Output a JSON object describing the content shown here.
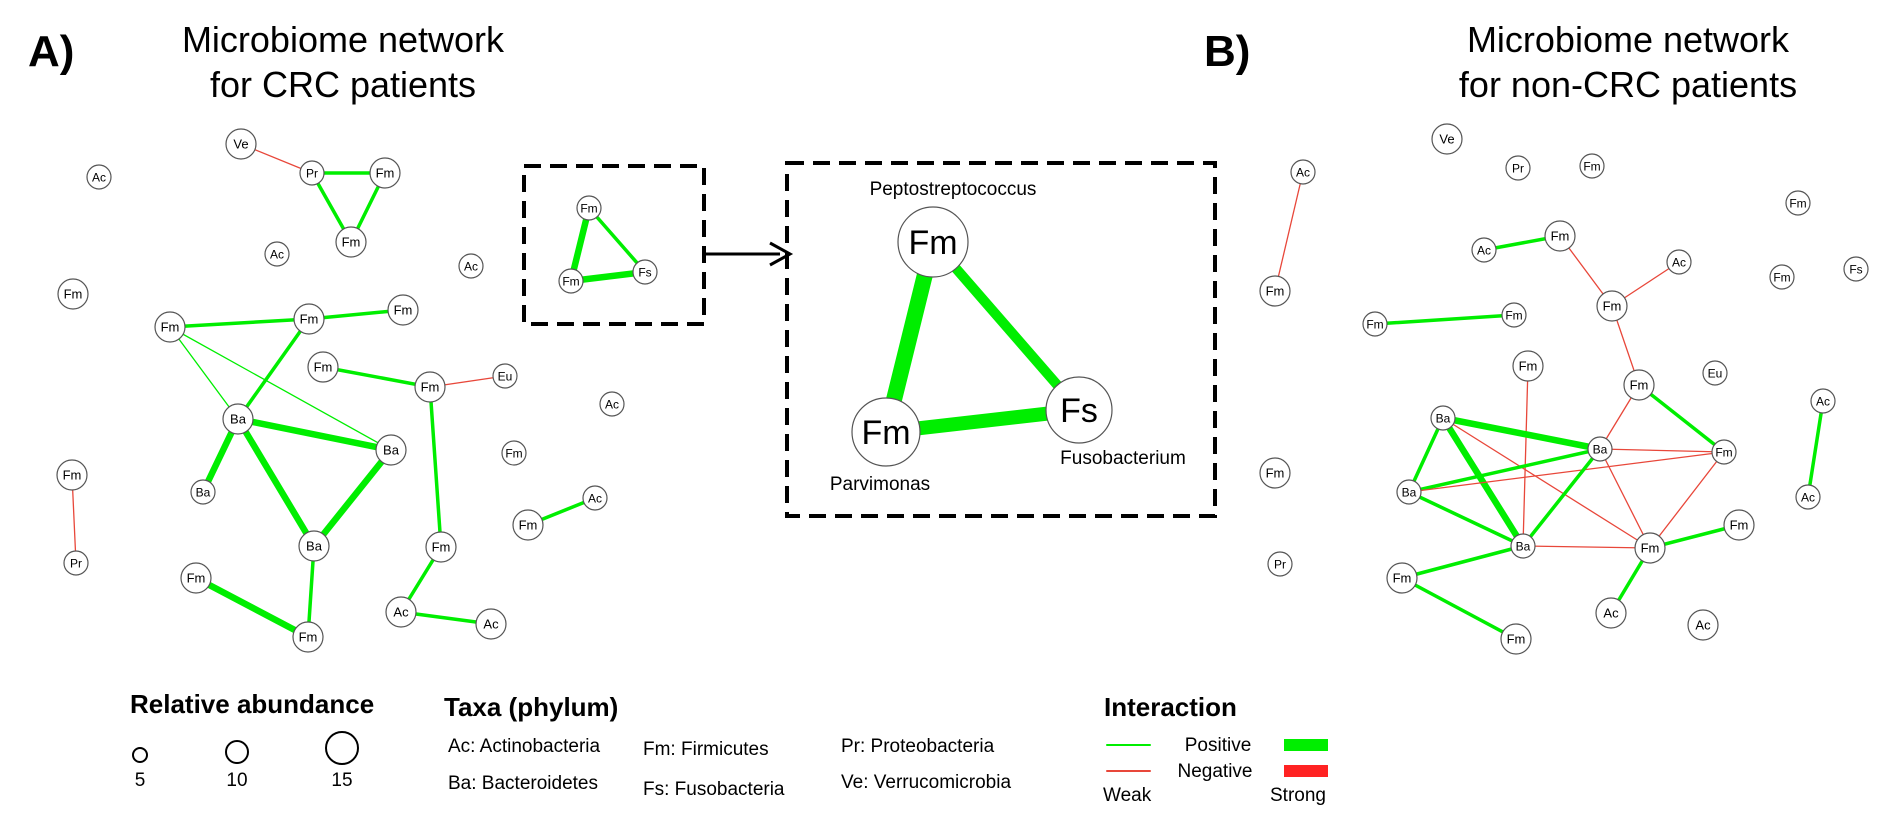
{
  "panel_a": {
    "letter": "A)",
    "title_line1": "Microbiome network",
    "title_line2": "for CRC patients"
  },
  "panel_b": {
    "letter": "B)",
    "title_line1": "Microbiome network",
    "title_line2": "for non-CRC patients"
  },
  "zoom": {
    "top_label": "Peptostreptococcus",
    "left_label": "Parvimonas",
    "right_label": "Fusobacterium",
    "nodes": [
      "Fm",
      "Fm",
      "Fs"
    ]
  },
  "legend": {
    "abundance": {
      "title": "Relative abundance",
      "sizes": [
        "5",
        "10",
        "15"
      ]
    },
    "taxa": {
      "title": "Taxa (phylum)",
      "entries": [
        "Ac: Actinobacteria",
        "Ba: Bacteroidetes",
        "Fm: Firmicutes",
        "Fs: Fusobacteria",
        "Pr: Proteobacteria",
        "Ve: Verrucomicrobia"
      ]
    },
    "interaction": {
      "title": "Interaction",
      "positive": "Positive",
      "negative": "Negative",
      "weak": "Weak",
      "strong": "Strong",
      "colors": {
        "positive": "#00ee00",
        "negative": "#e8473a"
      }
    }
  },
  "network_a": {
    "nodes": [
      {
        "id": "a1",
        "label": "Ve",
        "size": "m"
      },
      {
        "id": "a2",
        "label": "Pr",
        "size": "s"
      },
      {
        "id": "a3",
        "label": "Fm",
        "size": "m"
      },
      {
        "id": "a4",
        "label": "Fm",
        "size": "m"
      },
      {
        "id": "a5",
        "label": "Ac",
        "size": "s"
      },
      {
        "id": "a6",
        "label": "Ac",
        "size": "s"
      },
      {
        "id": "a7",
        "label": "Ac",
        "size": "s"
      },
      {
        "id": "a8",
        "label": "Fm",
        "size": "m"
      },
      {
        "id": "a9",
        "label": "Fm",
        "size": "m"
      },
      {
        "id": "a10",
        "label": "Fm",
        "size": "m"
      },
      {
        "id": "a11",
        "label": "Fm",
        "size": "m"
      },
      {
        "id": "a12",
        "label": "Fm",
        "size": "m"
      },
      {
        "id": "a13",
        "label": "Fm",
        "size": "m"
      },
      {
        "id": "a14",
        "label": "Eu",
        "size": "s"
      },
      {
        "id": "a15",
        "label": "Ac",
        "size": "s"
      },
      {
        "id": "a16",
        "label": "Ba",
        "size": "m"
      },
      {
        "id": "a17",
        "label": "Ba",
        "size": "m"
      },
      {
        "id": "a18",
        "label": "Ba",
        "size": "s"
      },
      {
        "id": "a19",
        "label": "Fm",
        "size": "s"
      },
      {
        "id": "a20",
        "label": "Fm",
        "size": "m"
      },
      {
        "id": "a21",
        "label": "Pr",
        "size": "s"
      },
      {
        "id": "a22",
        "label": "Ac",
        "size": "s"
      },
      {
        "id": "a23",
        "label": "Fm",
        "size": "m"
      },
      {
        "id": "a24",
        "label": "Ba",
        "size": "m"
      },
      {
        "id": "a25",
        "label": "Fm",
        "size": "m"
      },
      {
        "id": "a26",
        "label": "Fm",
        "size": "m"
      },
      {
        "id": "a27",
        "label": "Fm",
        "size": "m"
      },
      {
        "id": "a28",
        "label": "Ac",
        "size": "m"
      },
      {
        "id": "a29",
        "label": "Ac",
        "size": "m"
      },
      {
        "id": "a30",
        "label": "Fm",
        "size": "s"
      },
      {
        "id": "a31",
        "label": "Fm",
        "size": "s"
      },
      {
        "id": "a32",
        "label": "Fs",
        "size": "s"
      }
    ],
    "edges": [
      {
        "from": "a1",
        "to": "a2",
        "sign": "negative",
        "strength": "weak"
      },
      {
        "from": "a2",
        "to": "a3",
        "sign": "positive",
        "strength": "medium"
      },
      {
        "from": "a2",
        "to": "a4",
        "sign": "positive",
        "strength": "medium"
      },
      {
        "from": "a3",
        "to": "a4",
        "sign": "positive",
        "strength": "medium"
      },
      {
        "from": "a9",
        "to": "a10",
        "sign": "positive",
        "strength": "medium"
      },
      {
        "from": "a10",
        "to": "a11",
        "sign": "positive",
        "strength": "medium"
      },
      {
        "from": "a9",
        "to": "a16",
        "sign": "positive",
        "strength": "weak"
      },
      {
        "from": "a9",
        "to": "a17",
        "sign": "positive",
        "strength": "weak"
      },
      {
        "from": "a10",
        "to": "a16",
        "sign": "positive",
        "strength": "medium"
      },
      {
        "from": "a16",
        "to": "a17",
        "sign": "positive",
        "strength": "strong"
      },
      {
        "from": "a16",
        "to": "a18",
        "sign": "positive",
        "strength": "strong"
      },
      {
        "from": "a16",
        "to": "a24",
        "sign": "positive",
        "strength": "strong"
      },
      {
        "from": "a17",
        "to": "a24",
        "sign": "positive",
        "strength": "strong"
      },
      {
        "from": "a24",
        "to": "a26",
        "sign": "positive",
        "strength": "medium"
      },
      {
        "from": "a25",
        "to": "a26",
        "sign": "positive",
        "strength": "strong"
      },
      {
        "from": "a12",
        "to": "a13",
        "sign": "positive",
        "strength": "medium"
      },
      {
        "from": "a13",
        "to": "a14",
        "sign": "negative",
        "strength": "weak"
      },
      {
        "from": "a13",
        "to": "a27",
        "sign": "positive",
        "strength": "medium"
      },
      {
        "from": "a27",
        "to": "a28",
        "sign": "positive",
        "strength": "medium"
      },
      {
        "from": "a28",
        "to": "a29",
        "sign": "positive",
        "strength": "medium"
      },
      {
        "from": "a20",
        "to": "a21",
        "sign": "negative",
        "strength": "weak"
      },
      {
        "from": "a22",
        "to": "a23",
        "sign": "positive",
        "strength": "medium"
      },
      {
        "from": "a30",
        "to": "a31",
        "sign": "positive",
        "strength": "strong"
      },
      {
        "from": "a30",
        "to": "a32",
        "sign": "positive",
        "strength": "medium"
      },
      {
        "from": "a31",
        "to": "a32",
        "sign": "positive",
        "strength": "strong"
      }
    ]
  },
  "network_b": {
    "nodes": [
      {
        "id": "b1",
        "label": "Ac",
        "size": "s"
      },
      {
        "id": "b2",
        "label": "Fm",
        "size": "m"
      },
      {
        "id": "b3",
        "label": "Fm",
        "size": "m"
      },
      {
        "id": "b4",
        "label": "Pr",
        "size": "s"
      },
      {
        "id": "b5",
        "label": "Ve",
        "size": "m"
      },
      {
        "id": "b6",
        "label": "Pr",
        "size": "s"
      },
      {
        "id": "b7",
        "label": "Fm",
        "size": "s"
      },
      {
        "id": "b8",
        "label": "Fm",
        "size": "s"
      },
      {
        "id": "b9",
        "label": "Fm",
        "size": "s"
      },
      {
        "id": "b10",
        "label": "Fs",
        "size": "s"
      },
      {
        "id": "b11",
        "label": "Ac",
        "size": "s"
      },
      {
        "id": "b12",
        "label": "Fm",
        "size": "m"
      },
      {
        "id": "b13",
        "label": "Ac",
        "size": "s"
      },
      {
        "id": "b14",
        "label": "Fm",
        "size": "s"
      },
      {
        "id": "b15",
        "label": "Fm",
        "size": "s"
      },
      {
        "id": "b16",
        "label": "Fm",
        "size": "m"
      },
      {
        "id": "b17",
        "label": "Fm",
        "size": "m"
      },
      {
        "id": "b18",
        "label": "Eu",
        "size": "s"
      },
      {
        "id": "b19",
        "label": "Fm",
        "size": "m"
      },
      {
        "id": "b20",
        "label": "Ac",
        "size": "s"
      },
      {
        "id": "b21",
        "label": "Ba",
        "size": "s"
      },
      {
        "id": "b22",
        "label": "Ba",
        "size": "s"
      },
      {
        "id": "b23",
        "label": "Fm",
        "size": "s"
      },
      {
        "id": "b24",
        "label": "Ba",
        "size": "s"
      },
      {
        "id": "b25",
        "label": "Ac",
        "size": "s"
      },
      {
        "id": "b26",
        "label": "Fm",
        "size": "m"
      },
      {
        "id": "b27",
        "label": "Ba",
        "size": "s"
      },
      {
        "id": "b28",
        "label": "Fm",
        "size": "m"
      },
      {
        "id": "b29",
        "label": "Fm",
        "size": "m"
      },
      {
        "id": "b30",
        "label": "Ac",
        "size": "m"
      },
      {
        "id": "b31",
        "label": "Ac",
        "size": "m"
      },
      {
        "id": "b32",
        "label": "Fm",
        "size": "m"
      }
    ],
    "edges": [
      {
        "from": "b1",
        "to": "b2",
        "sign": "negative",
        "strength": "weak"
      },
      {
        "from": "b11",
        "to": "b12",
        "sign": "positive",
        "strength": "medium"
      },
      {
        "from": "b12",
        "to": "b16",
        "sign": "negative",
        "strength": "weak"
      },
      {
        "from": "b13",
        "to": "b16",
        "sign": "negative",
        "strength": "weak"
      },
      {
        "from": "b16",
        "to": "b19",
        "sign": "negative",
        "strength": "weak"
      },
      {
        "from": "b14",
        "to": "b15",
        "sign": "positive",
        "strength": "medium"
      },
      {
        "from": "b19",
        "to": "b22",
        "sign": "negative",
        "strength": "weak"
      },
      {
        "from": "b19",
        "to": "b23",
        "sign": "positive",
        "strength": "medium"
      },
      {
        "from": "b17",
        "to": "b27",
        "sign": "negative",
        "strength": "weak"
      },
      {
        "from": "b21",
        "to": "b22",
        "sign": "positive",
        "strength": "strong"
      },
      {
        "from": "b21",
        "to": "b24",
        "sign": "positive",
        "strength": "medium"
      },
      {
        "from": "b21",
        "to": "b27",
        "sign": "positive",
        "strength": "strong"
      },
      {
        "from": "b21",
        "to": "b28",
        "sign": "negative",
        "strength": "weak"
      },
      {
        "from": "b24",
        "to": "b22",
        "sign": "positive",
        "strength": "medium"
      },
      {
        "from": "b24",
        "to": "b27",
        "sign": "positive",
        "strength": "medium"
      },
      {
        "from": "b24",
        "to": "b23",
        "sign": "negative",
        "strength": "weak"
      },
      {
        "from": "b22",
        "to": "b27",
        "sign": "positive",
        "strength": "medium"
      },
      {
        "from": "b22",
        "to": "b23",
        "sign": "negative",
        "strength": "weak"
      },
      {
        "from": "b22",
        "to": "b28",
        "sign": "negative",
        "strength": "weak"
      },
      {
        "from": "b27",
        "to": "b28",
        "sign": "negative",
        "strength": "weak"
      },
      {
        "from": "b27",
        "to": "b29",
        "sign": "positive",
        "strength": "medium"
      },
      {
        "from": "b23",
        "to": "b28",
        "sign": "negative",
        "strength": "weak"
      },
      {
        "from": "b28",
        "to": "b26",
        "sign": "positive",
        "strength": "medium"
      },
      {
        "from": "b28",
        "to": "b30",
        "sign": "positive",
        "strength": "medium"
      },
      {
        "from": "b29",
        "to": "b32",
        "sign": "positive",
        "strength": "medium"
      },
      {
        "from": "b20",
        "to": "b25",
        "sign": "positive",
        "strength": "medium"
      }
    ]
  }
}
